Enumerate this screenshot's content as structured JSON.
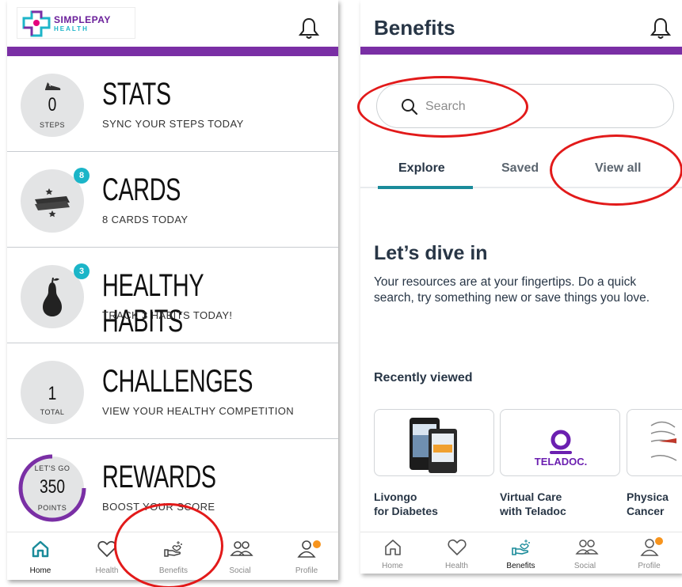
{
  "left_screen": {
    "logo": {
      "brand": "SIMPLEPAY",
      "sub": "HEALTH"
    },
    "rows": [
      {
        "title": "STATS",
        "subtitle": "SYNC YOUR STEPS TODAY",
        "value": "0",
        "unit": "STEPS",
        "icon": "sneaker-icon"
      },
      {
        "title": "CARDS",
        "subtitle": "8 CARDS TODAY",
        "badge": "8",
        "icon": "cards-icon"
      },
      {
        "title": "HEALTHY HABITS",
        "subtitle": "TRACK 3 HABITS TODAY!",
        "badge": "3",
        "icon": "pear-icon"
      },
      {
        "title": "CHALLENGES",
        "subtitle": "VIEW YOUR HEALTHY COMPETITION",
        "value": "1",
        "unit": "TOTAL"
      },
      {
        "title": "REWARDS",
        "subtitle": "BOOST YOUR SCORE",
        "top_label": "LET'S GO",
        "value": "350",
        "unit": "POINTS"
      }
    ],
    "nav": [
      {
        "label": "Home",
        "icon": "home-icon",
        "active": true
      },
      {
        "label": "Health",
        "icon": "heart-icon"
      },
      {
        "label": "Benefits",
        "icon": "benefits-hand-icon"
      },
      {
        "label": "Social",
        "icon": "social-icon"
      },
      {
        "label": "Profile",
        "icon": "profile-icon"
      }
    ]
  },
  "right_screen": {
    "title": "Benefits",
    "search": {
      "placeholder": "Search"
    },
    "tabs": [
      {
        "label": "Explore",
        "active": true
      },
      {
        "label": "Saved"
      },
      {
        "label": "View all"
      }
    ],
    "heading": "Let’s dive in",
    "paragraph": "Your resources are at your fingertips. Do a quick search, try something new or save things you love.",
    "recent_title": "Recently viewed",
    "recent_items": [
      {
        "line1": "Livongo",
        "line2": "for Diabetes"
      },
      {
        "line1": "Virtual Care",
        "line2": "with Teladoc",
        "logo_text": "TELADOC."
      },
      {
        "line1": "Physica",
        "line2": "Cancer"
      }
    ],
    "nav": [
      {
        "label": "Home",
        "icon": "home-icon"
      },
      {
        "label": "Health",
        "icon": "heart-icon"
      },
      {
        "label": "Benefits",
        "icon": "benefits-hand-icon",
        "active": true
      },
      {
        "label": "Social",
        "icon": "social-icon"
      },
      {
        "label": "Profile",
        "icon": "profile-icon"
      }
    ]
  },
  "colors": {
    "purple_bar": "#7a2fa5",
    "badge": "#1bb5c8",
    "tab_underline": "#1a8b9a",
    "annotation": "#e21a1a",
    "notification_dot": "#f7941d"
  }
}
